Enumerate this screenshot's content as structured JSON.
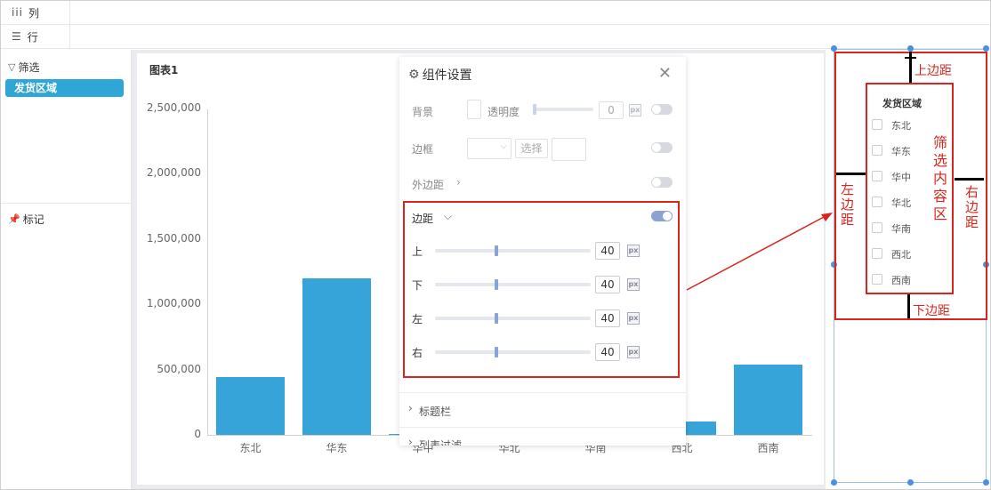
{
  "shelves": {
    "columns": {
      "icon": "iii",
      "label": "列"
    },
    "rows": {
      "icon": "☰",
      "label": "行"
    }
  },
  "left": {
    "filter_title": "筛选",
    "filter_chip": "发货区域",
    "mark_title": "标记"
  },
  "chart": {
    "title": "图表1"
  },
  "chart_data": {
    "type": "bar",
    "categories": [
      "东北",
      "华东",
      "华中",
      "华北",
      "华南",
      "西北",
      "西南"
    ],
    "values": [
      440000,
      1200000,
      10000,
      0,
      0,
      100000,
      540000
    ],
    "ylim": [
      0,
      2500000
    ],
    "yticks": [
      "0",
      "500,000",
      "1,000,000",
      "1,500,000",
      "2,000,000",
      "2,500,000"
    ],
    "xlabel": "",
    "ylabel": "",
    "color": "#36a3d9"
  },
  "panel": {
    "title": "组件设置",
    "background": {
      "label": "背景",
      "opacity_label": "透明度",
      "opacity_value": "0",
      "unit": "px"
    },
    "border": {
      "label": "边框",
      "select_label": "选择"
    },
    "margin": {
      "label": "外边距"
    },
    "padding": {
      "label": "边距",
      "unit": "px",
      "items": [
        {
          "label": "上",
          "value": "40"
        },
        {
          "label": "下",
          "value": "40"
        },
        {
          "label": "左",
          "value": "40"
        },
        {
          "label": "右",
          "value": "40"
        }
      ]
    },
    "title_bar": "标题栏",
    "list_filter": "列表过滤"
  },
  "preview": {
    "filter_title": "发货区域",
    "items": [
      "东北",
      "华东",
      "华中",
      "华北",
      "华南",
      "西北",
      "西南"
    ],
    "annotations": {
      "top": "上边距",
      "bottom": "下边距",
      "left": "左边距",
      "right": "右边距",
      "content": "筛选内容区"
    }
  },
  "colors": {
    "accent": "#2ea7d6",
    "bar": "#36a3d9",
    "annotation": "#d9251d"
  }
}
